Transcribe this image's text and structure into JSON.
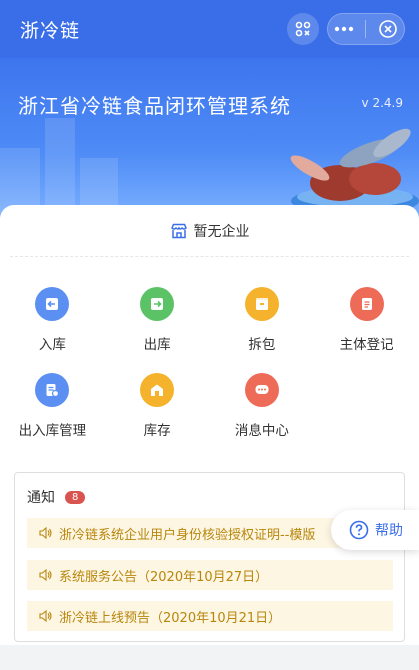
{
  "navbar": {
    "title": "浙冷链",
    "icons": [
      "scan-icon",
      "more-icon",
      "close-icon"
    ]
  },
  "banner": {
    "title": "浙江省冷链食品闭环管理系统",
    "version": "v 2.4.9"
  },
  "company": {
    "icon": "store-icon",
    "label": "暂无企业"
  },
  "menu": [
    {
      "label": "入库",
      "icon": "inbound-icon",
      "color": "#5b8ff2"
    },
    {
      "label": "出库",
      "icon": "outbound-icon",
      "color": "#5cc266"
    },
    {
      "label": "拆包",
      "icon": "unpack-icon",
      "color": "#f5b22c"
    },
    {
      "label": "主体登记",
      "icon": "register-icon",
      "color": "#ee6b57"
    },
    {
      "label": "出入库管理",
      "icon": "manage-icon",
      "color": "#5b8ff2"
    },
    {
      "label": "库存",
      "icon": "inventory-icon",
      "color": "#f5b22c"
    },
    {
      "label": "消息中心",
      "icon": "message-icon",
      "color": "#ee6b57"
    }
  ],
  "notice": {
    "title": "通知",
    "badge": "8",
    "items": [
      "浙冷链系统企业用户身份核验授权证明--模版",
      "系统服务公告（2020年10月27日）",
      "浙冷链上线预告（2020年10月21日）"
    ]
  },
  "help": {
    "label": "帮助",
    "icon": "question-icon"
  },
  "colors": {
    "primary": "#3a6ee8",
    "notice_bg": "#fdf6e3",
    "notice_text": "#b8860b"
  }
}
